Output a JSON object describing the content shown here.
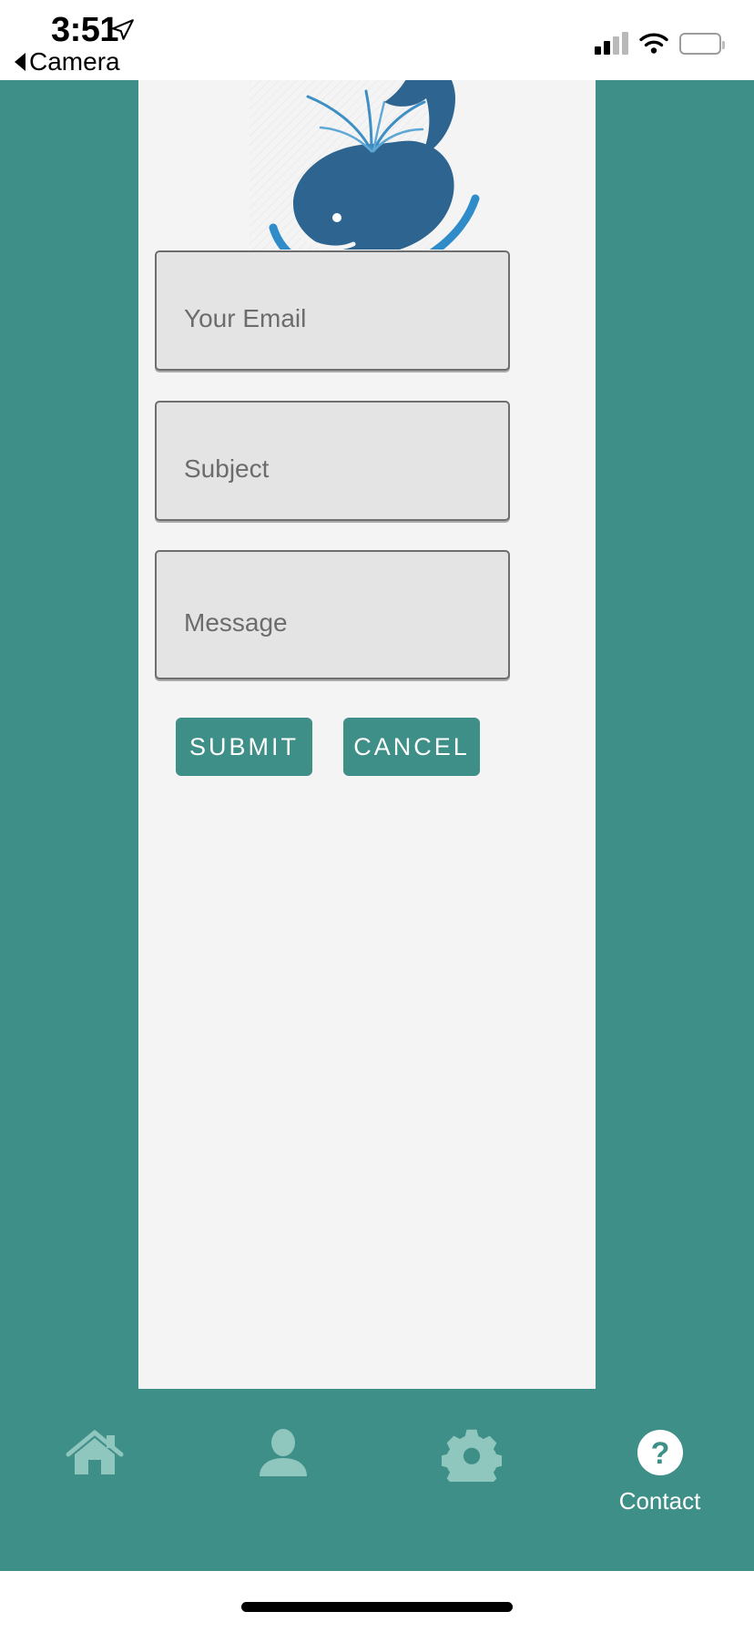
{
  "status_bar": {
    "time": "3:51",
    "back_label": "Camera",
    "location_icon": "location-arrow-icon",
    "signal_icon": "cellular-signal-icon",
    "wifi_icon": "wifi-icon",
    "battery_icon": "battery-icon"
  },
  "theme": {
    "accent_teal": "#3E8F87",
    "panel_bg": "#F4F4F4",
    "field_bg": "#E4E4E4",
    "field_border": "#6E6E6E",
    "placeholder_text": "#6C6C6C",
    "logo_blue": "#2E6490",
    "logo_light_blue": "#3E8FC4",
    "inactive_icon": "#8FC6BE",
    "active_icon": "#FFFFFF"
  },
  "logo": {
    "icon": "whale-logo-icon",
    "alt": "Whale logo"
  },
  "form": {
    "fields": [
      {
        "name": "email",
        "placeholder": "Your Email"
      },
      {
        "name": "subject",
        "placeholder": "Subject"
      },
      {
        "name": "message",
        "placeholder": "Message"
      }
    ],
    "buttons": [
      {
        "name": "submit",
        "label": "SUBMIT"
      },
      {
        "name": "cancel",
        "label": "CANCEL"
      }
    ]
  },
  "tabbar": {
    "items": [
      {
        "name": "home",
        "icon": "home-icon",
        "label": "",
        "active": false
      },
      {
        "name": "profile",
        "icon": "person-icon",
        "label": "",
        "active": false
      },
      {
        "name": "settings",
        "icon": "gear-icon",
        "label": "",
        "active": false
      },
      {
        "name": "contact",
        "icon": "question-mark-circle-icon",
        "label": "Contact",
        "active": true
      }
    ]
  }
}
